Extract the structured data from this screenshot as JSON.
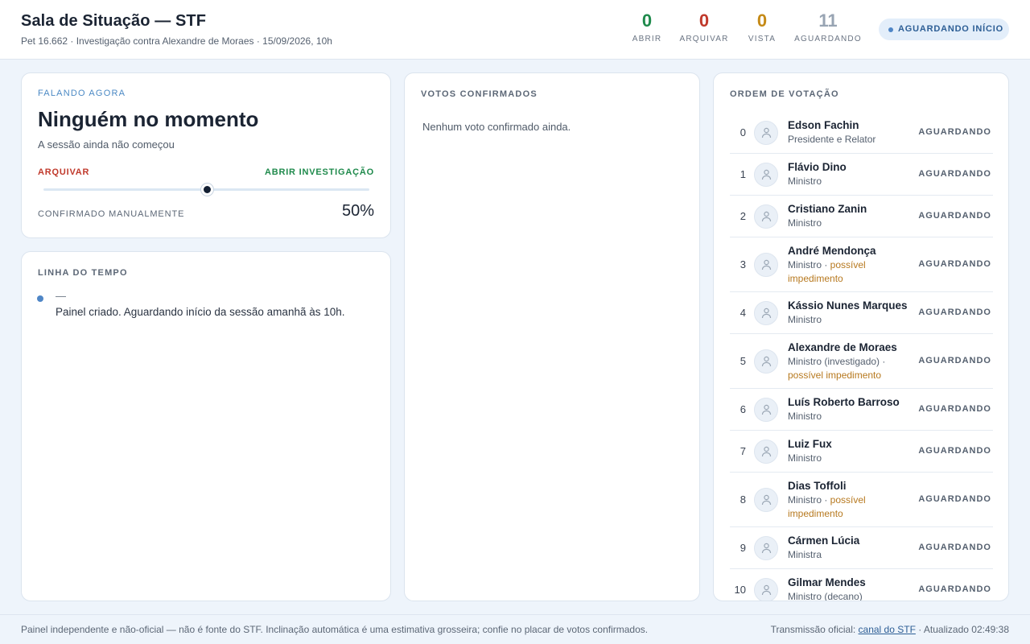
{
  "header": {
    "title": "Sala de Situação — STF",
    "subtitle": "Pet 16.662 · Investigação contra Alexandre de Moraes · 15/09/2026, 10h",
    "counters": [
      {
        "value": "0",
        "label": "ABRIR",
        "color": "#1f8a4c"
      },
      {
        "value": "0",
        "label": "ARQUIVAR",
        "color": "#c0392b"
      },
      {
        "value": "0",
        "label": "VISTA",
        "color": "#c58a17"
      },
      {
        "value": "11",
        "label": "AGUARDANDO",
        "color": "#98a4b3"
      }
    ],
    "status": "AGUARDANDO INÍCIO"
  },
  "speaking": {
    "label": "FALANDO AGORA",
    "name": "Ninguém no momento",
    "detail": "A sessão ainda não começou",
    "left_label": "ARQUIVAR",
    "right_label": "ABRIR INVESTIGAÇÃO",
    "lean_fraction": 0.5,
    "confirm_label": "CONFIRMADO MANUALMENTE",
    "percent": "50%"
  },
  "timeline": {
    "label": "LINHA DO TEMPO",
    "entries": [
      {
        "time": "—",
        "text": "Painel criado. Aguardando início da sessão amanhã às 10h."
      }
    ]
  },
  "votes": {
    "label": "VOTOS CONFIRMADOS",
    "empty": "Nenhum voto confirmado ainda."
  },
  "order": {
    "label": "ORDEM DE VOTAÇÃO",
    "rows": [
      {
        "idx": "0",
        "name": "Edson Fachin",
        "role": "Presidente e Relator",
        "warn": "",
        "state": "AGUARDANDO"
      },
      {
        "idx": "1",
        "name": "Flávio Dino",
        "role": "Ministro",
        "warn": "",
        "state": "AGUARDANDO"
      },
      {
        "idx": "2",
        "name": "Cristiano Zanin",
        "role": "Ministro",
        "warn": "",
        "state": "AGUARDANDO"
      },
      {
        "idx": "3",
        "name": "André Mendonça",
        "role": "Ministro · ",
        "warn": "possível impedimento",
        "state": "AGUARDANDO"
      },
      {
        "idx": "4",
        "name": "Kássio Nunes Marques",
        "role": "Ministro",
        "warn": "",
        "state": "AGUARDANDO"
      },
      {
        "idx": "5",
        "name": "Alexandre de Moraes",
        "role": "Ministro (investigado) · ",
        "warn": "possível impedimento",
        "state": "AGUARDANDO"
      },
      {
        "idx": "6",
        "name": "Luís Roberto Barroso",
        "role": "Ministro",
        "warn": "",
        "state": "AGUARDANDO"
      },
      {
        "idx": "7",
        "name": "Luiz Fux",
        "role": "Ministro",
        "warn": "",
        "state": "AGUARDANDO"
      },
      {
        "idx": "8",
        "name": "Dias Toffoli",
        "role": "Ministro · ",
        "warn": "possível impedimento",
        "state": "AGUARDANDO"
      },
      {
        "idx": "9",
        "name": "Cármen Lúcia",
        "role": "Ministra",
        "warn": "",
        "state": "AGUARDANDO"
      },
      {
        "idx": "10",
        "name": "Gilmar Mendes",
        "role": "Ministro (decano)",
        "warn": "",
        "state": "AGUARDANDO"
      }
    ]
  },
  "footer": {
    "disclaimer": "Painel independente e não-oficial — não é fonte do STF. Inclinação automática é uma estimativa grosseira; confie no placar de votos confirmados.",
    "official_prefix": "Transmissão oficial: ",
    "official_link": "canal do STF",
    "updated": " · Atualizado 02:49:38"
  }
}
